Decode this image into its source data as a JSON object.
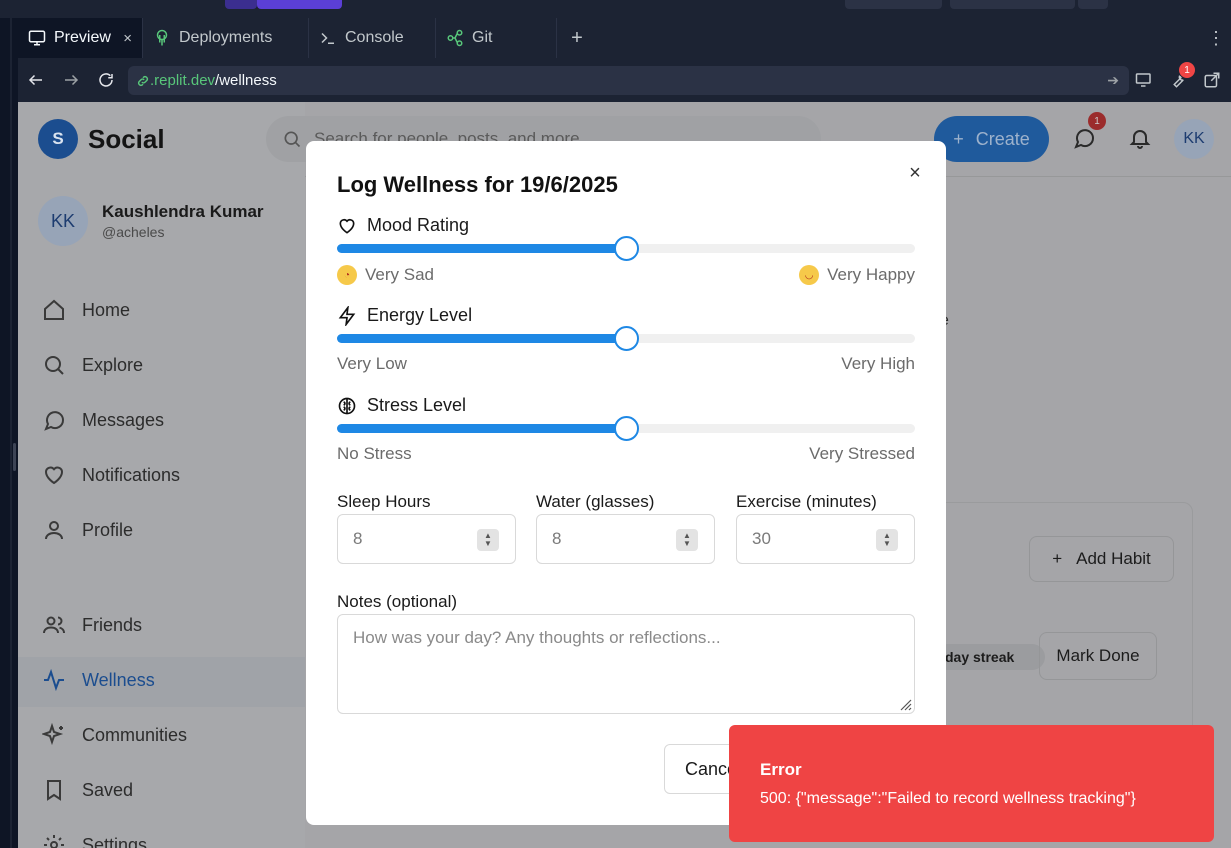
{
  "browser": {
    "tabs": [
      {
        "label": "Preview",
        "close": "×"
      },
      {
        "label": "Deployments"
      },
      {
        "label": "Console"
      },
      {
        "label": "Git"
      }
    ],
    "new_tab": "+",
    "menu": "⋮",
    "url_domain": ".replit.dev",
    "url_path": "/wellness",
    "devtools_badge": "1"
  },
  "app": {
    "brand_letter": "S",
    "brand_name": "Social",
    "search_placeholder": "Search for people, posts, and more...",
    "create_label": "Create",
    "messages_badge": "1",
    "user_initials": "KK",
    "profile": {
      "name": "Kaushlendra Kumar",
      "handle": "@acheles",
      "initials": "KK"
    },
    "nav": [
      {
        "label": "Home",
        "icon": "home-icon"
      },
      {
        "label": "Explore",
        "icon": "search-icon"
      },
      {
        "label": "Messages",
        "icon": "message-icon"
      },
      {
        "label": "Notifications",
        "icon": "heart-icon"
      },
      {
        "label": "Profile",
        "icon": "user-icon"
      },
      {
        "label": "Friends",
        "icon": "users-icon"
      },
      {
        "label": "Wellness",
        "icon": "activity-icon"
      },
      {
        "label": "Communities",
        "icon": "sparkles-icon"
      },
      {
        "label": "Saved",
        "icon": "bookmark-icon"
      },
      {
        "label": "Settings",
        "icon": "settings-icon"
      }
    ],
    "add_habit": "Add Habit",
    "streak": "day streak",
    "mark_done": "Mark Done",
    "fragment": "e"
  },
  "modal": {
    "title": "Log Wellness for 19/6/2025",
    "close": "×",
    "mood": {
      "label": "Mood Rating",
      "low": "Very Sad",
      "high": "Very Happy",
      "value": 0.5
    },
    "energy": {
      "label": "Energy Level",
      "low": "Very Low",
      "high": "Very High",
      "value": 0.5
    },
    "stress": {
      "label": "Stress Level",
      "low": "No Stress",
      "high": "Very Stressed",
      "value": 0.5
    },
    "sleep": {
      "label": "Sleep Hours",
      "value": "8"
    },
    "water": {
      "label": "Water (glasses)",
      "value": "8"
    },
    "exercise": {
      "label": "Exercise (minutes)",
      "value": "30"
    },
    "notes": {
      "label": "Notes (optional)",
      "placeholder": "How was your day? Any thoughts or reflections..."
    },
    "cancel": "Cancel"
  },
  "toast": {
    "title": "Error",
    "message": "500: {\"message\":\"Failed to record wellness tracking\"}"
  },
  "colors": {
    "accent": "#1e88e5",
    "error": "#ef4444",
    "brand": "#1b4d8f"
  }
}
